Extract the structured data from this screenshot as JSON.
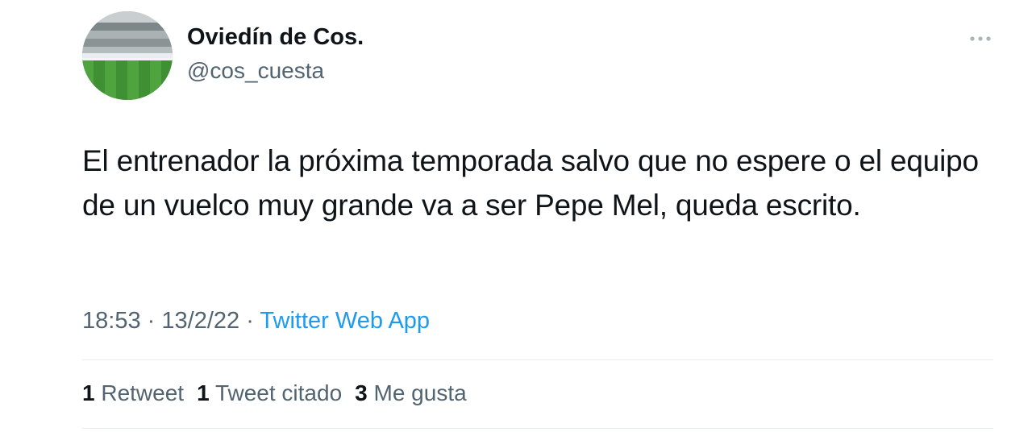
{
  "tweet": {
    "author": {
      "name": "Oviedín de Cos.",
      "handle": "@cos_cuesta",
      "avatar_icon": "stadium-avatar"
    },
    "more_icon": "more-horizontal-icon",
    "text": "El entrenador la próxima temporada salvo que no espere o el equipo de un vuelco muy grande va a ser Pepe Mel, queda escrito.",
    "time": "18:53",
    "separator": "·",
    "date": "13/2/22",
    "source": "Twitter Web App",
    "stats": {
      "retweets": {
        "count": "1",
        "label": "Retweet"
      },
      "quotes": {
        "count": "1",
        "label": "Tweet citado"
      },
      "likes": {
        "count": "3",
        "label": "Me gusta"
      }
    }
  },
  "colors": {
    "text_primary": "#0f1419",
    "text_secondary": "#536471",
    "link": "#1d9bf0",
    "divider": "#e6ebee"
  }
}
